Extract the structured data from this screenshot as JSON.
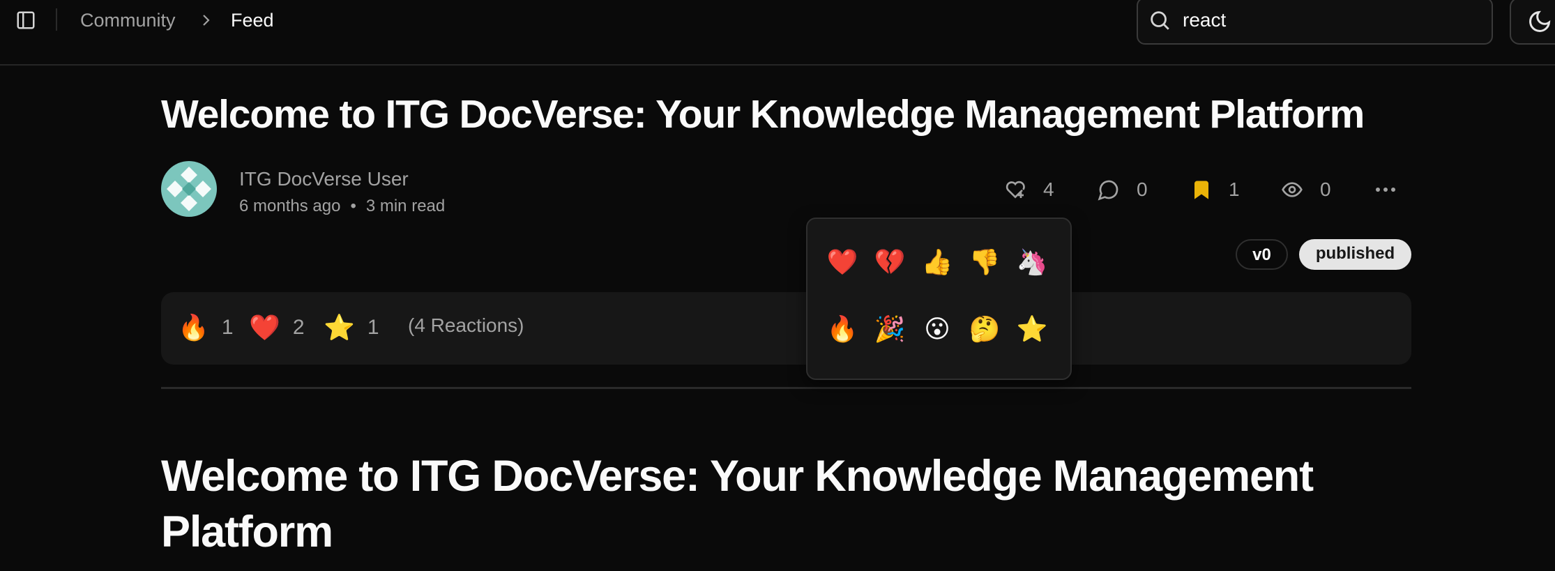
{
  "header": {
    "breadcrumb": {
      "parent": "Community",
      "current": "Feed"
    },
    "search": {
      "value": "react",
      "placeholder": "Search"
    },
    "theme_toggle": {
      "icon": "moon-icon"
    }
  },
  "post": {
    "title": "Welcome to ITG DocVerse: Your Knowledge Management Platform",
    "author": "ITG DocVerse User",
    "posted": "6 months ago",
    "meta_separator": "•",
    "read_time": "3 min read",
    "stats": {
      "likes": "4",
      "comments": "0",
      "bookmarks": "1",
      "views": "0"
    },
    "version_badge": "v0",
    "status_badge": "published",
    "reactions": [
      {
        "emoji": "🔥",
        "count": "1"
      },
      {
        "emoji": "❤️",
        "count": "2"
      },
      {
        "emoji": "⭐",
        "count": "1"
      }
    ],
    "reactions_total": "(4 Reactions)",
    "content_title": "Welcome to ITG DocVerse: Your Knowledge Management Platform"
  },
  "emoji_picker": {
    "emojis": [
      "❤️",
      "💔",
      "👍",
      "👎",
      "🦄",
      "🔥",
      "🎉",
      "😮",
      "🤔",
      "⭐"
    ]
  },
  "colors": {
    "background": "#0a0a0a",
    "muted_text": "#a3a3a3",
    "bookmark_accent": "#eab308",
    "avatar_teal": "#7cc6bd"
  }
}
